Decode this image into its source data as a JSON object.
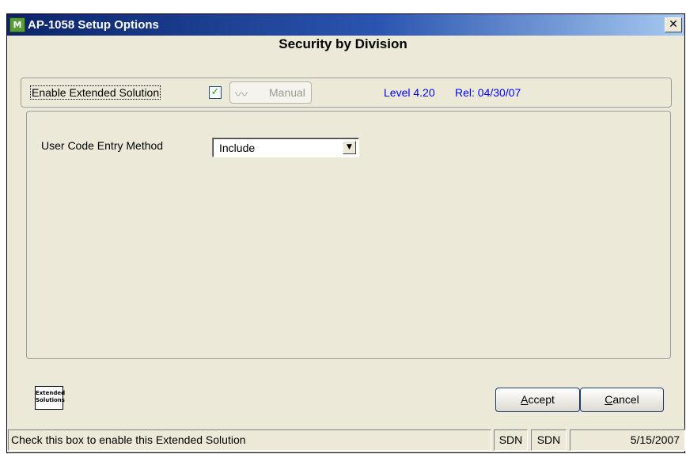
{
  "window": {
    "title": "AP-1058 Setup Options",
    "app_icon_text": "M",
    "close_glyph": "✕"
  },
  "heading": "Security by Division",
  "enable": {
    "label": "Enable Extended Solution",
    "checked": true,
    "check_glyph": "✓"
  },
  "manual_button": {
    "label": "Manual",
    "enabled": false,
    "glyph": "〰"
  },
  "version": {
    "level": "Level 4.20",
    "rel": "Rel: 04/30/07"
  },
  "user_code": {
    "label": "User Code Entry Method",
    "value": "Include",
    "arrow": "▼"
  },
  "logo": {
    "line1": "Extended",
    "line2": "Solutions"
  },
  "buttons": {
    "accept": "Accept",
    "cancel": "Cancel"
  },
  "statusbar": {
    "message": "Check this box to enable this Extended Solution",
    "user1": "SDN",
    "user2": "SDN",
    "date": "5/15/2007"
  },
  "colors": {
    "version_text": "#0000ff",
    "check": "#21a121",
    "title_gradient_start": "#0a246a"
  }
}
